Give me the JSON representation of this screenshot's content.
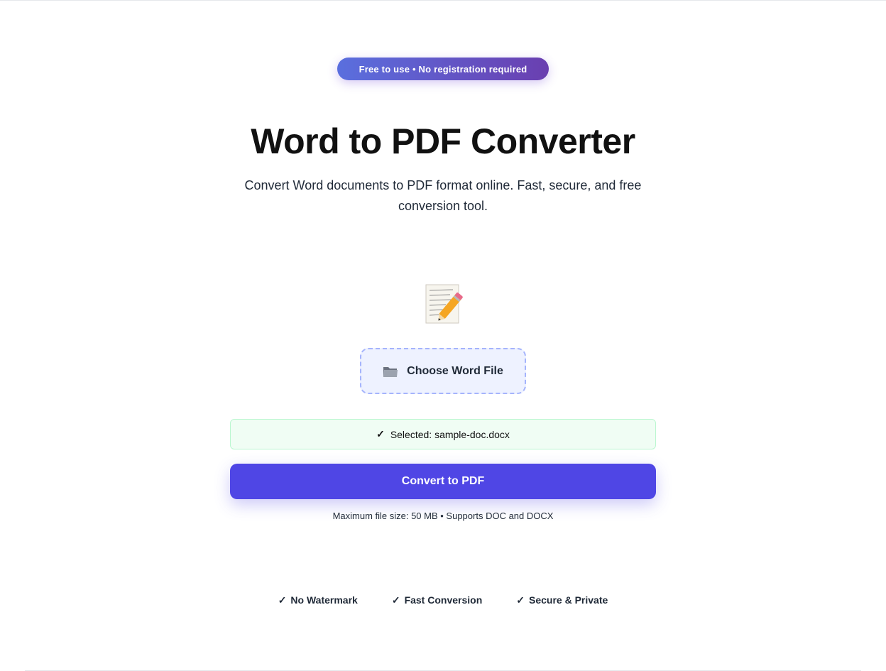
{
  "hero": {
    "badge": "Free to use • No registration required",
    "title": "Word to PDF Converter",
    "subtitle": "Convert Word documents to PDF format online. Fast, secure, and free conversion tool.",
    "icon": "memo-pencil-icon"
  },
  "upload": {
    "choose_label": "Choose Word File",
    "choose_icon": "folder-icon",
    "selected_check": "✓",
    "selected_text": "Selected: sample-doc.docx",
    "convert_label": "Convert to PDF",
    "info": "Maximum file size: 50 MB • Supports DOC and DOCX"
  },
  "features": [
    {
      "check": "✓",
      "label": "No Watermark"
    },
    {
      "check": "✓",
      "label": "Fast Conversion"
    },
    {
      "check": "✓",
      "label": "Secure & Private"
    }
  ],
  "colors": {
    "accent": "#4f46e5",
    "badge_start": "#5a6fde",
    "badge_end": "#6a3fb0",
    "success_bg": "#f0fdf4",
    "success_border": "#bbf7d0",
    "upload_bg": "#eef2ff",
    "upload_border": "#a5b4fc"
  }
}
